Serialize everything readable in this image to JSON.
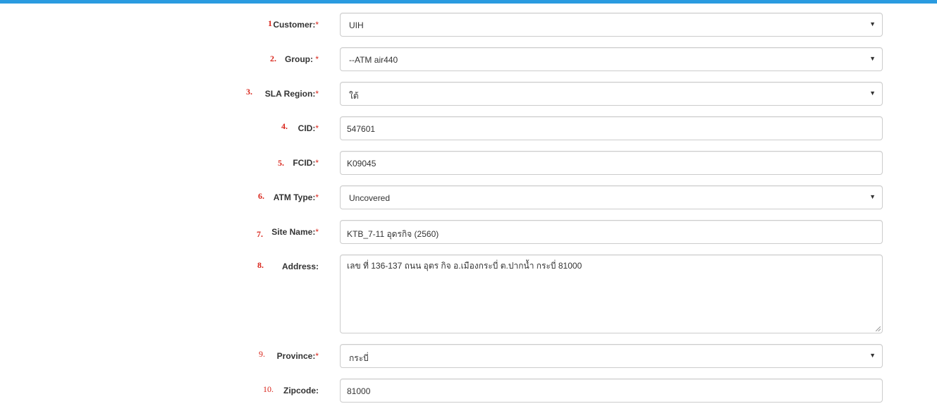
{
  "form": {
    "fields": [
      {
        "num": "1",
        "label": "Customer:",
        "required": "*",
        "value": "UIH",
        "type": "select"
      },
      {
        "num": "2.",
        "label": "Group:",
        "required": "*",
        "value": "--ATM air440",
        "type": "select"
      },
      {
        "num": "3.",
        "label": "SLA Region:",
        "required": "*",
        "value": "ใต้",
        "type": "select"
      },
      {
        "num": "4.",
        "label": "CID:",
        "required": "*",
        "value": "547601",
        "type": "input"
      },
      {
        "num": "5.",
        "label": "FCID:",
        "required": "*",
        "value": "K09045",
        "type": "input"
      },
      {
        "num": "6.",
        "label": "ATM Type:",
        "required": "*",
        "value": "Uncovered",
        "type": "select"
      },
      {
        "num": "7.",
        "label": "Site Name:",
        "required": "*",
        "value": "KTB_7-11 อุดรกิจ (2560)",
        "type": "input"
      },
      {
        "num": "8.",
        "label": "Address:",
        "required": "",
        "value": "เลข ที่ 136-137 ถนน อุตร กิจ อ.เมืองกระบี่ ต.ปากน้ำ กระบี่ 81000",
        "type": "textarea"
      },
      {
        "num": "9.",
        "label": "Province:",
        "required": "*",
        "value": "กระบี่",
        "type": "select"
      },
      {
        "num": "10.",
        "label": "Zipcode:",
        "required": "",
        "value": "81000",
        "type": "input"
      }
    ]
  },
  "colors": {
    "accent": "#2a9be0",
    "required": "#d9261c",
    "border": "#cccccc"
  }
}
